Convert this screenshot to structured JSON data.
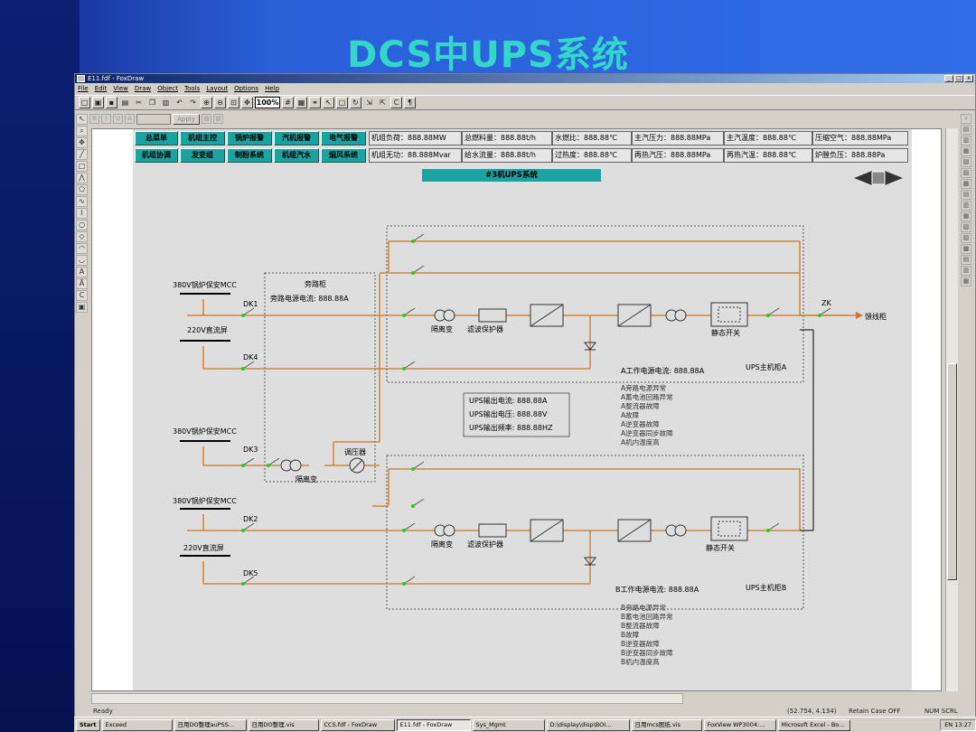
{
  "slide": {
    "title": "DCS中UPS系统"
  },
  "window": {
    "title": "E11.fdf - FoxDraw",
    "buttons": [
      "_",
      "□",
      "x"
    ]
  },
  "menu": [
    "File",
    "Edit",
    "View",
    "Draw",
    "Object",
    "Tools",
    "Layout",
    "Options",
    "Help"
  ],
  "toolbar": {
    "zoom": "100%",
    "apply_label": "Apply"
  },
  "nav_buttons": [
    [
      "总菜单",
      "机组主控",
      "锅炉报警",
      "汽机报警",
      "电气报警"
    ],
    [
      "机组协调",
      "发变组",
      "制粉系统",
      "机组汽水",
      "烟风系统"
    ]
  ],
  "info_cells": [
    [
      "机组负荷：888.88MW",
      "总燃料量：888.88t/h",
      "水燃比：888.88℃",
      "主汽压力：888.88MPa",
      "主汽温度：888.88℃",
      "压缩空气：888.88MPa"
    ],
    [
      "机组无功：88.888Mvar",
      "给水流量：888.88t/h",
      "过热度：888.88℃",
      "再热汽压：888.88MPa",
      "再热汽温：888.88℃",
      "炉膛负压：888.88Pa"
    ]
  ],
  "diagram": {
    "banner": "#3机UPS系统",
    "labels": {
      "mcc1": "380V锅炉保安MCC",
      "dc1": "220V直流屏",
      "mcc2": "380V锅炉保安MCC",
      "mcc3": "380V锅炉保安MCC",
      "dc2": "220V直流屏",
      "dk1": "DK1",
      "dk4": "DK4",
      "dk3": "DK3",
      "dk2": "DK2",
      "dk5": "DK5",
      "bypass_cabinet": "旁路柜",
      "bypass_current": "旁路电源电流:   888.88A",
      "iso_a": "隔离变",
      "filter_a": "滤波保护器",
      "static_a": "静态开关",
      "iso_b": "隔离变",
      "filter_b": "滤波保护器",
      "static_b": "静态开关",
      "iso_bypass": "隔离变",
      "regulator": "调压器",
      "zk": "ZK",
      "load": "馈线柜",
      "a_current": "A工作电源电流: 888.88A",
      "a_host": "UPS主机柜A",
      "b_current": "B工作电源电流: 888.88A",
      "b_host": "UPS主机柜B"
    },
    "ups_output": [
      "UPS输出电流:  888.88A",
      "UPS输出电压:  888.88V",
      "UPS输出频率:  888.88HZ"
    ],
    "alarms_a": [
      "A旁路电源异常",
      "A蓄电池回路异常",
      "A整流器故障",
      "A故障",
      "A逆变器故障",
      "A逆变器同步故障",
      "A机内温度高"
    ],
    "alarms_b": [
      "B旁路电源异常",
      "B蓄电池回路异常",
      "B整流器故障",
      "B故障",
      "B逆变器故障",
      "B逆变器同步故障",
      "B机内温度高"
    ]
  },
  "status": {
    "left": "Ready",
    "coords": "(52.754, 4.134)",
    "case": "Retain Case OFF",
    "num": "NUM SCRL"
  },
  "taskbar": {
    "items": [
      "Start",
      "Exceed",
      "日用DO整理auPSS...",
      "日用DO整理.vis",
      "CCS.fdf - FoxDraw",
      "E11.fdf - FoxDraw",
      "Sys_Mgmt",
      "D:\\display\\disp\\BOI...",
      "日用mcs图纸.vis",
      "FoxView WP3004:...",
      "Microsoft Excel - Bo..."
    ],
    "clock": "13:27",
    "lang": "EN"
  },
  "colors": {
    "wire": "#c8781e",
    "teal": "#1aa3a0",
    "switch_green": "#22cc22",
    "slide_title": "#33d6c8"
  }
}
